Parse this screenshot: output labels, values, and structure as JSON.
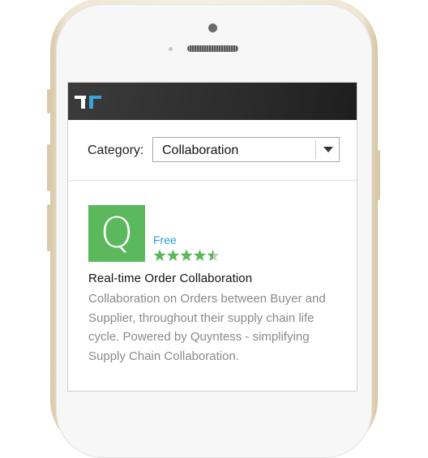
{
  "category": {
    "label": "Category:",
    "selected": "Collaboration"
  },
  "app": {
    "icon_letter": "Q",
    "icon_color": "#5cb85c",
    "price": "Free",
    "rating": 4.5,
    "rating_max": 5,
    "title": "Real-time Order Collaboration",
    "description": "Collaboration on Orders between Buyer and Supplier, throughout their supply chain life cycle. Powered by Quyntess - simplifying Supply Chain Collaboration."
  },
  "colors": {
    "accent_link": "#2a9fd6",
    "star": "#5cb85c",
    "header_bg": "#2c2c2c"
  }
}
